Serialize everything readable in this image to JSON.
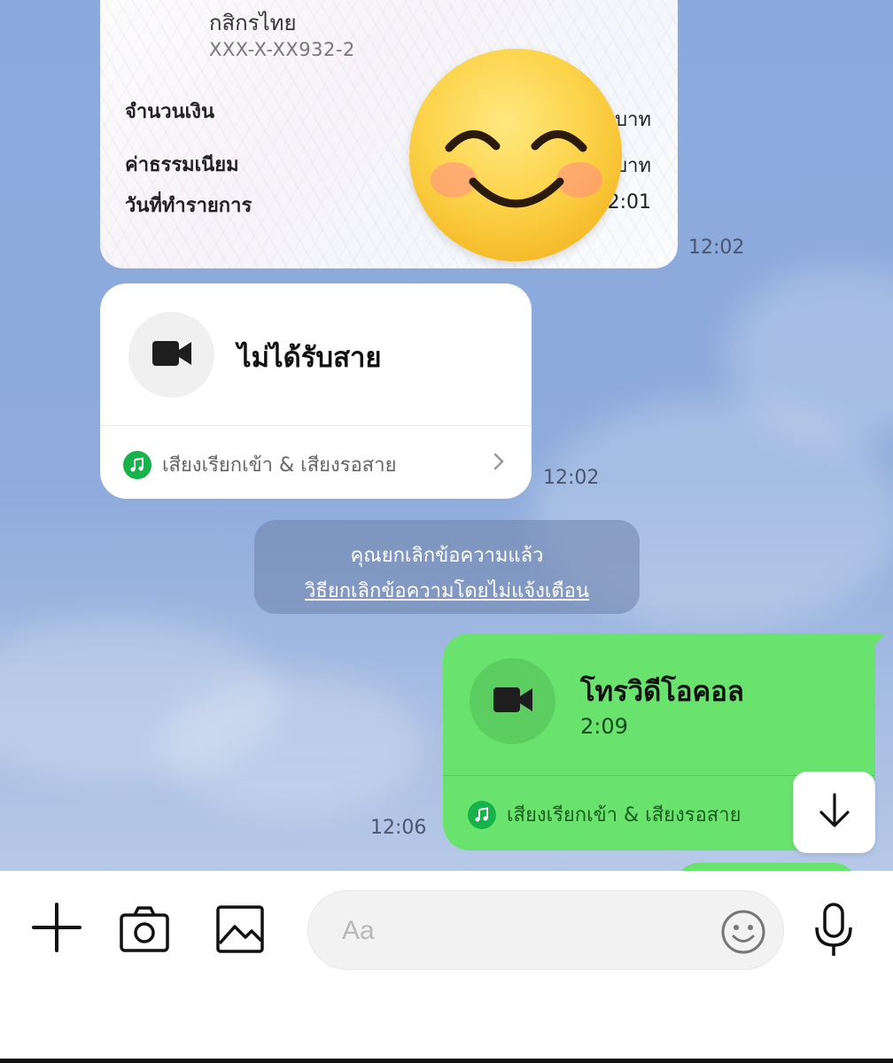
{
  "slip": {
    "bank": "กสิกรไทย",
    "account": "XXX-X-XX932-2",
    "rows": [
      {
        "label": "จำนวนเงิน",
        "value": "บาท"
      },
      {
        "label": "ค่าธรรมเนียม",
        "value": "บาท"
      },
      {
        "label": "วันที่ทำรายการ",
        "value": "2:01"
      }
    ],
    "time": "12:02",
    "sticker_icon": "smiling-face-emoji"
  },
  "missed_call": {
    "icon": "video-camera-icon",
    "title": "ไม่ได้รับสาย",
    "ringtone_label": "เสียงเรียกเข้า & เสียงรอสาย",
    "time": "12:02"
  },
  "system_notice": {
    "line1": "คุณยกเลิกข้อความแล้ว",
    "link": "วิธียกเลิกข้อความโดยไม่แจ้งเตือน"
  },
  "video_call": {
    "icon": "video-camera-icon",
    "title": "โทรวิดีโอคอล",
    "duration": "2:09",
    "ringtone_label": "เสียงเรียกเข้า & เสียงรอสาย",
    "time": "12:06"
  },
  "input": {
    "placeholder": "Aa"
  },
  "colors": {
    "sent_bubble": "#6ae36e",
    "chat_background": "#8fadda",
    "music_badge": "#17b34a"
  }
}
